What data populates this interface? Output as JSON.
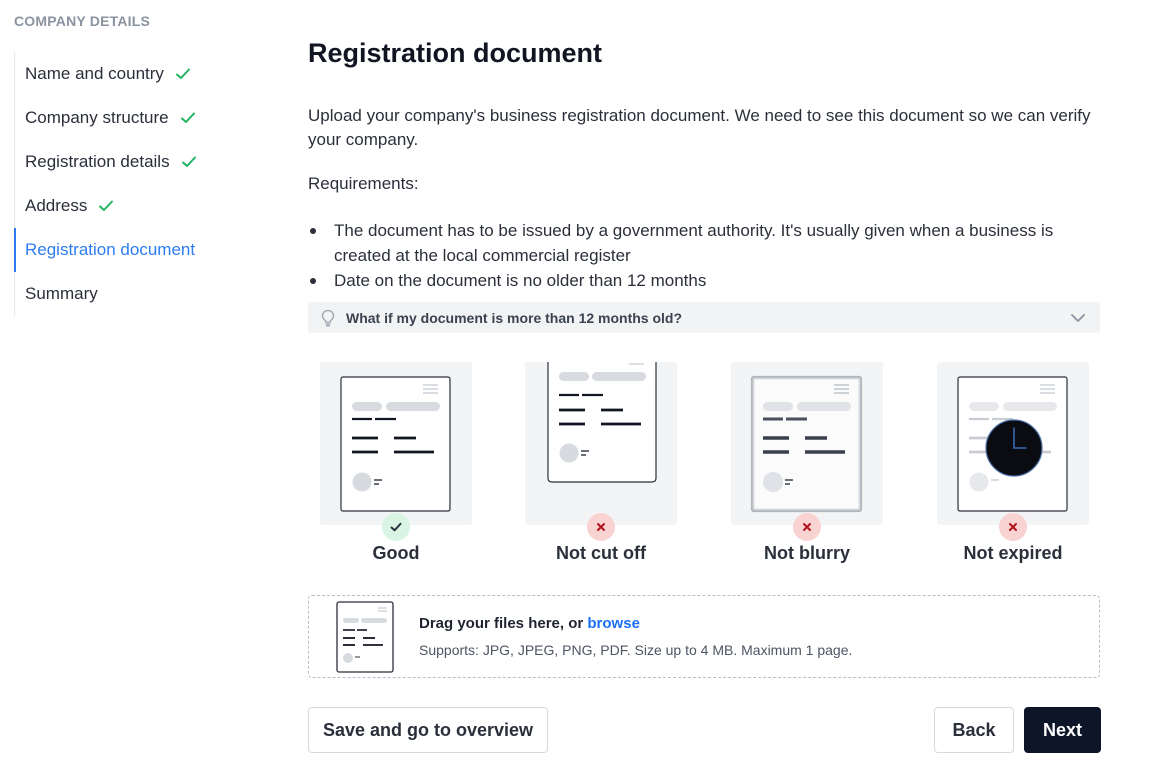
{
  "sidebar": {
    "heading": "COMPANY DETAILS",
    "items": [
      {
        "label": "Name and country",
        "completed": true
      },
      {
        "label": "Company structure",
        "completed": true
      },
      {
        "label": "Registration details",
        "completed": true
      },
      {
        "label": "Address",
        "completed": true
      },
      {
        "label": "Registration document",
        "active": true
      },
      {
        "label": "Summary"
      }
    ]
  },
  "main": {
    "title": "Registration document",
    "intro": "Upload your company's business registration document. We need to see this document so we can verify your company.",
    "requirements_heading": "Requirements:",
    "requirements": [
      "The document has to be issued by a government authority. It's usually given when a business is created at the local commercial register",
      "Date on the document is no older than 12 months"
    ],
    "accordion": {
      "label": "What if my document is more than 12 months old?",
      "expanded": false
    },
    "examples": [
      {
        "label": "Good",
        "status": "good"
      },
      {
        "label": "Not cut off",
        "status": "bad"
      },
      {
        "label": "Not blurry",
        "status": "bad"
      },
      {
        "label": "Not expired",
        "status": "bad"
      }
    ],
    "dropzone": {
      "title_prefix": "Drag your files here, or",
      "browse_label": "browse",
      "supports": "Supports: JPG, JPEG, PNG, PDF. Size up to 4 MB. Maximum 1 page."
    }
  },
  "actions": {
    "save_label": "Save and go to overview",
    "back_label": "Back",
    "next_label": "Next"
  },
  "colors": {
    "accent": "#2d7cf3",
    "success": "#22b35e",
    "error": "#c1121f",
    "primary_button": "#0c1628"
  }
}
